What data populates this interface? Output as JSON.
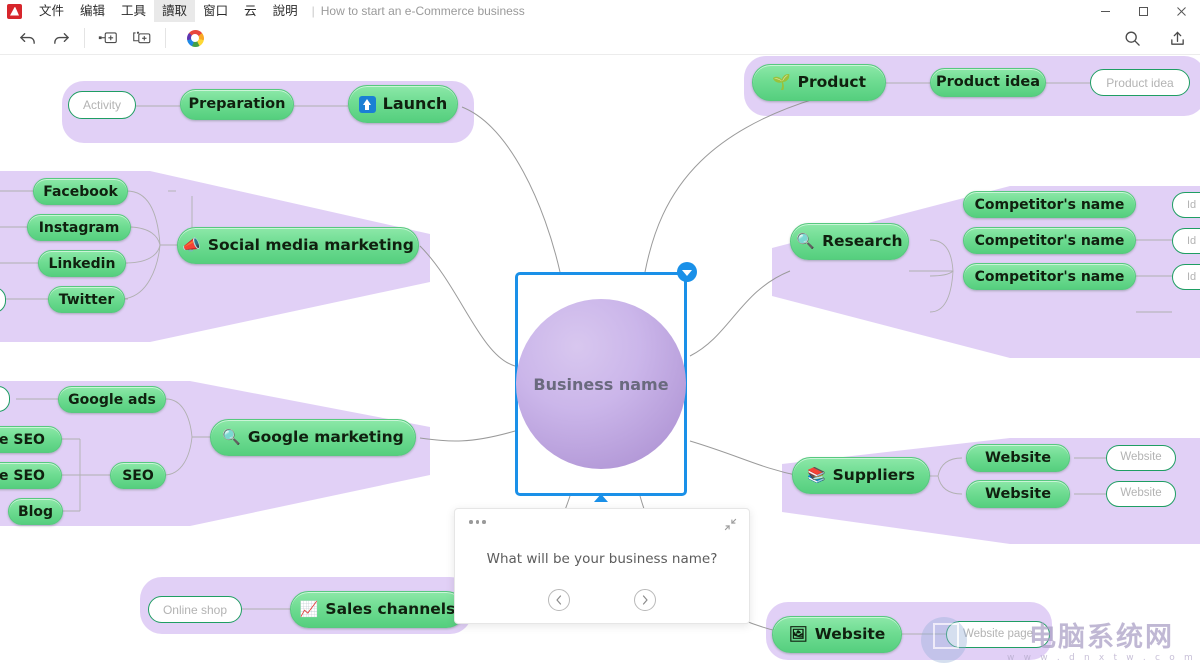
{
  "titlebar": {
    "logo_icon": "app-logo-icon",
    "menus": [
      {
        "label": "文件",
        "active": false
      },
      {
        "label": "编辑",
        "active": false
      },
      {
        "label": "工具",
        "active": false
      },
      {
        "label": "讀取",
        "active": true
      },
      {
        "label": "窗口",
        "active": false
      },
      {
        "label": "云",
        "active": false
      },
      {
        "label": "說明",
        "active": false
      }
    ],
    "separator": "|",
    "document_title": "How to start an e-Commerce business",
    "window_controls": [
      {
        "name": "minimize-button",
        "label": "—"
      },
      {
        "name": "maximize-button",
        "label": "▢"
      },
      {
        "name": "close-button",
        "label": "✕"
      }
    ]
  },
  "toolbar": {
    "undo": "undo-icon",
    "redo": "redo-icon",
    "add_topic": "add-topic-icon",
    "add_subtopic": "add-subtopic-icon",
    "theme_color": "color-wheel-icon",
    "search": "search-icon",
    "share": "share-icon"
  },
  "central": {
    "label": "Business name",
    "selected": true,
    "accent_color": "#1a90e8",
    "fill_color": "#c2abe4"
  },
  "question_card": {
    "text": "What will be your business name?",
    "prev_label": "‹",
    "next_label": "›",
    "menu_icon": "more-dots-icon",
    "collapse_icon": "collapse-icon"
  },
  "branches": {
    "activity": {
      "nodes": [
        {
          "label": "Activity",
          "style": "outline"
        },
        {
          "label": "Preparation",
          "style": "green"
        },
        {
          "label": "Launch",
          "style": "green",
          "icon": "⬆"
        }
      ]
    },
    "social": {
      "parent": {
        "label": "Social media marketing",
        "style": "green",
        "icon": "📣"
      },
      "children": [
        {
          "label": "Facebook",
          "style": "green"
        },
        {
          "label": "Instagram",
          "style": "green"
        },
        {
          "label": "Linkedin",
          "style": "green"
        },
        {
          "label": "Twitter",
          "style": "green"
        }
      ],
      "edge_nodes": [
        {
          "label": ")",
          "style": "outline"
        }
      ]
    },
    "google": {
      "parent": {
        "label": "Google marketing",
        "style": "green",
        "icon": "🔍"
      },
      "children": [
        {
          "label": "Google ads",
          "style": "green"
        },
        {
          "label": "SEO",
          "style": "green"
        }
      ],
      "seo_children": [
        {
          "label": "ge SEO",
          "style": "green"
        },
        {
          "label": "ge SEO",
          "style": "green"
        },
        {
          "label": "Blog",
          "style": "green"
        }
      ]
    },
    "sales": {
      "nodes": [
        {
          "label": "Online shop",
          "style": "outline"
        },
        {
          "label": "Sales channels",
          "style": "green",
          "icon": "📈"
        }
      ]
    },
    "product": {
      "nodes": [
        {
          "label": "Product",
          "style": "green",
          "icon": "🌱"
        },
        {
          "label": "Product idea",
          "style": "green"
        },
        {
          "label": "Product idea",
          "style": "outline"
        }
      ]
    },
    "research": {
      "parent": {
        "label": "Research",
        "style": "green",
        "icon": "🔍"
      },
      "children": [
        {
          "label": "Competitor's name",
          "style": "green",
          "leaf": "Id"
        },
        {
          "label": "Competitor's name",
          "style": "green",
          "leaf": "Id"
        },
        {
          "label": "Competitor's name",
          "style": "green",
          "leaf": "Id"
        }
      ]
    },
    "suppliers": {
      "parent": {
        "label": "Suppliers",
        "style": "green",
        "icon": "📚"
      },
      "children": [
        {
          "label": "Website",
          "style": "green",
          "leaf": "Website"
        },
        {
          "label": "Website",
          "style": "green",
          "leaf": "Website"
        }
      ]
    },
    "website": {
      "nodes": [
        {
          "label": "Website",
          "style": "green",
          "icon": "🖼"
        },
        {
          "label": "Website page",
          "style": "outline"
        }
      ]
    }
  },
  "watermark": {
    "main": "电脑系统网",
    "sub": "w w w . d n x t w . c o m"
  }
}
